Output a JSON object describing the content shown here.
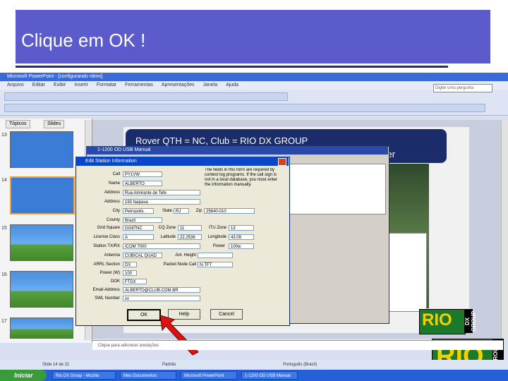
{
  "slide_title": "Clique em OK !",
  "app": {
    "window_title": "Microsoft PowerPoint - [configurando nlirim]",
    "menu": [
      "Arquivo",
      "Editar",
      "Exibir",
      "Inserir",
      "Formatar",
      "Ferramentas",
      "Apresentações",
      "Janela",
      "Ajuda"
    ],
    "help_placeholder": "Digite uma pergunta",
    "tabs": [
      "Tópicos",
      "Slides"
    ],
    "slide_numbers": [
      "13",
      "14",
      "15",
      "16",
      "17"
    ]
  },
  "slide": {
    "rover_line": "Rover QTH = NC, Club = RIO DX GROUP",
    "rover_sub": "ver"
  },
  "usb_window_title": "1-1200 OD USB Manual",
  "dialog": {
    "title": "Edit Station Information",
    "notice": "The fields in this form are required by contest log programs. If the call sign is not in a local database, you must enter the information manually.",
    "fields": [
      {
        "label": "Call",
        "value": "PY1VW"
      },
      {
        "label": "Name",
        "value": "ALBERTO"
      },
      {
        "label": "Address",
        "value": "Rua Almirante de Tefe"
      },
      {
        "label": "Address",
        "value": "193 Itaipava"
      },
      {
        "label": "City",
        "value": "Petropolis"
      },
      {
        "label": "County",
        "value": "Brazil"
      },
      {
        "label": "Grid Square",
        "value": "GG87NC"
      },
      {
        "label": "License Class",
        "value": "A"
      },
      {
        "label": "Station TX/RX",
        "value": "ICOM 7000"
      },
      {
        "label": "Antenna",
        "value": "CUBICAL QUAD"
      },
      {
        "label": "ARRL Section",
        "value": "DX"
      },
      {
        "label": "Power (W)",
        "value": "100"
      },
      {
        "label": "DOK",
        "value": "FTDX"
      },
      {
        "label": "Email Address",
        "value": "ALBERTO@CLUB.COM.BR"
      },
      {
        "label": "SWL Number",
        "value": "xx"
      }
    ],
    "state_label": "State",
    "state_value": "RJ",
    "zip_label": "Zip",
    "zip_value": "25640-010",
    "cq_label": "CQ Zone",
    "cq_value": "11",
    "itu_label": "ITU Zone",
    "itu_value": "13",
    "lat_label": "Latitude",
    "lat_value": "22.2536",
    "lon_label": "Longitude",
    "lon_value": "43.09",
    "power_label": "Power",
    "power_value": "100w",
    "height_label": "Ant. Height",
    "packet_label": "Packet Node Call",
    "packet_value": "N-TFT",
    "ok_label": "OK",
    "help_label": "Help",
    "cancel_label": "Cancel"
  },
  "logo_text": "RIO",
  "logo_sub": "DX GROUP",
  "notes_text": "Clique para adicionar anotações",
  "status": {
    "left": "Slide 14 de 21",
    "mid": "Padrão",
    "right": "Português (Brasil)"
  },
  "taskbar": {
    "start_label": "Iniciar",
    "tasks": [
      "Rio DX Group - Mozilla",
      "Meu Documentos",
      "Microsoft PowerPoint",
      "1-1200 OD USB Manual"
    ]
  },
  "accent": "#5b5bcc"
}
